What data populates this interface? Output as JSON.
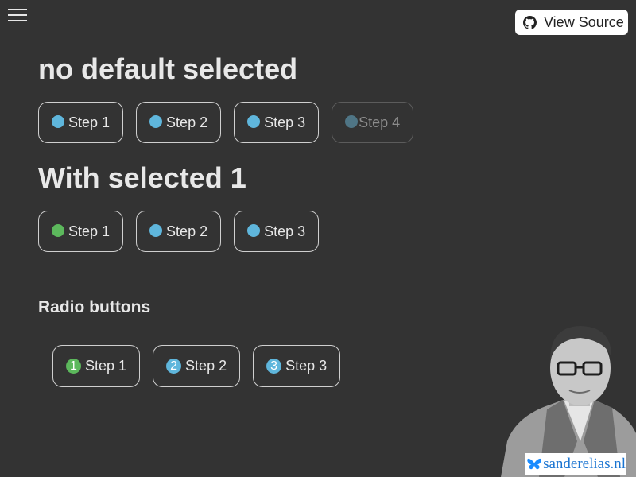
{
  "header": {
    "menu_icon": "hamburger-menu-icon",
    "view_source_label": "View Source",
    "view_source_icon": "github-icon"
  },
  "section1": {
    "title": "no default selected",
    "steps": [
      {
        "label": "Step 1",
        "state": "default"
      },
      {
        "label": "Step 2",
        "state": "default"
      },
      {
        "label": "Step 3",
        "state": "default"
      },
      {
        "label": "Step 4",
        "state": "disabled"
      }
    ]
  },
  "section2": {
    "title": "With selected 1",
    "steps": [
      {
        "label": "Step 1",
        "state": "selected"
      },
      {
        "label": "Step 2",
        "state": "default"
      },
      {
        "label": "Step 3",
        "state": "default"
      }
    ]
  },
  "section3": {
    "title": "Radio buttons",
    "steps": [
      {
        "number": "1",
        "label": "Step 1",
        "state": "selected"
      },
      {
        "number": "2",
        "label": "Step 2",
        "state": "default"
      },
      {
        "number": "3",
        "label": "Step 3",
        "state": "default"
      }
    ]
  },
  "brand": {
    "text": "sanderelias.nl",
    "icon": "butterfly-icon"
  },
  "colors": {
    "background": "#333333",
    "dot_default": "#5fb6dc",
    "dot_selected": "#5cb85c",
    "dot_disabled": "#4f7585",
    "brand_blue": "#1a74d1"
  }
}
